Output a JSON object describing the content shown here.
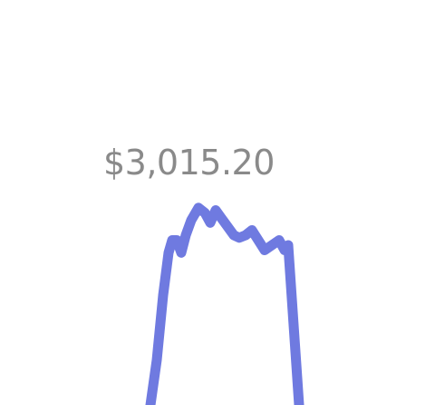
{
  "tooltip": {
    "value": "$3,015.20"
  },
  "chart_data": {
    "type": "line",
    "series": [
      {
        "values": [
          0,
          18,
          44,
          61,
          66,
          66,
          61,
          68,
          74,
          79,
          77,
          73,
          78,
          75,
          72,
          68,
          67,
          68,
          70,
          66,
          62,
          64,
          66,
          62,
          64,
          0
        ]
      }
    ]
  },
  "colors": {
    "line": "#6f7ae0",
    "label": "#8a8a8a",
    "background": "#ffffff"
  }
}
